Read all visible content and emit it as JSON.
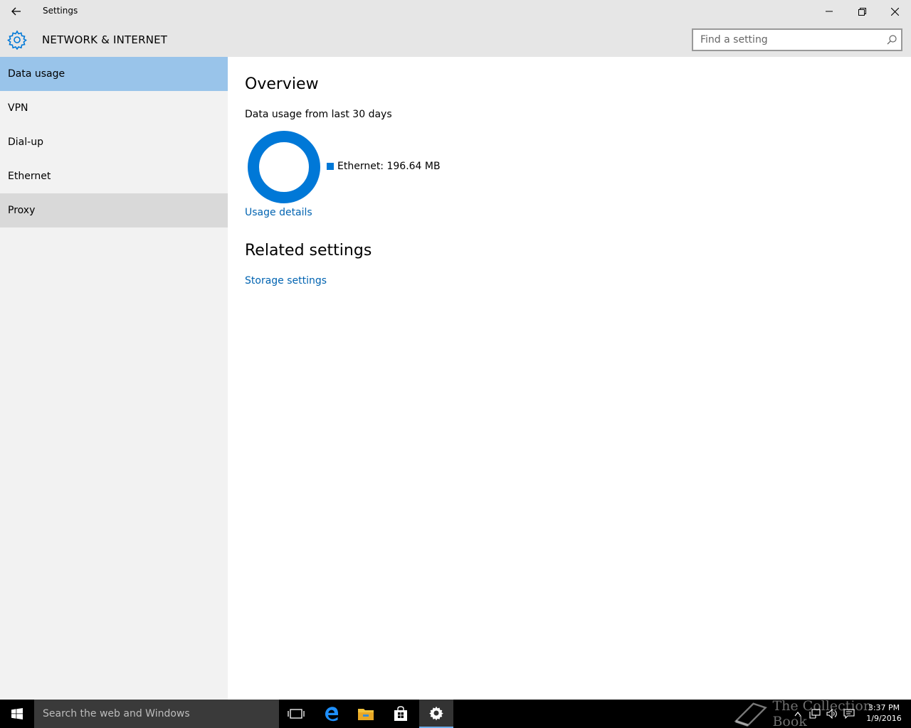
{
  "window": {
    "title": "Settings"
  },
  "header": {
    "section_title": "NETWORK & INTERNET",
    "search_placeholder": "Find a setting"
  },
  "sidebar": {
    "items": [
      {
        "label": "Data usage",
        "state": "selected"
      },
      {
        "label": "VPN",
        "state": "normal"
      },
      {
        "label": "Dial-up",
        "state": "normal"
      },
      {
        "label": "Ethernet",
        "state": "normal"
      },
      {
        "label": "Proxy",
        "state": "hovered"
      }
    ]
  },
  "main": {
    "overview_heading": "Overview",
    "usage_subtitle": "Data usage from last 30 days",
    "legend_label": "Ethernet: 196.64 MB",
    "usage_details_link": "Usage details",
    "related_heading": "Related settings",
    "storage_link": "Storage settings"
  },
  "taskbar": {
    "search_placeholder": "Search the web and Windows",
    "time": "3:37 PM",
    "date": "1/9/2016",
    "watermark": "The Collection Book"
  },
  "colors": {
    "accent": "#0078d7",
    "link": "#0063b1",
    "selected_nav": "#99c4ea",
    "chrome": "#e6e6e6"
  }
}
